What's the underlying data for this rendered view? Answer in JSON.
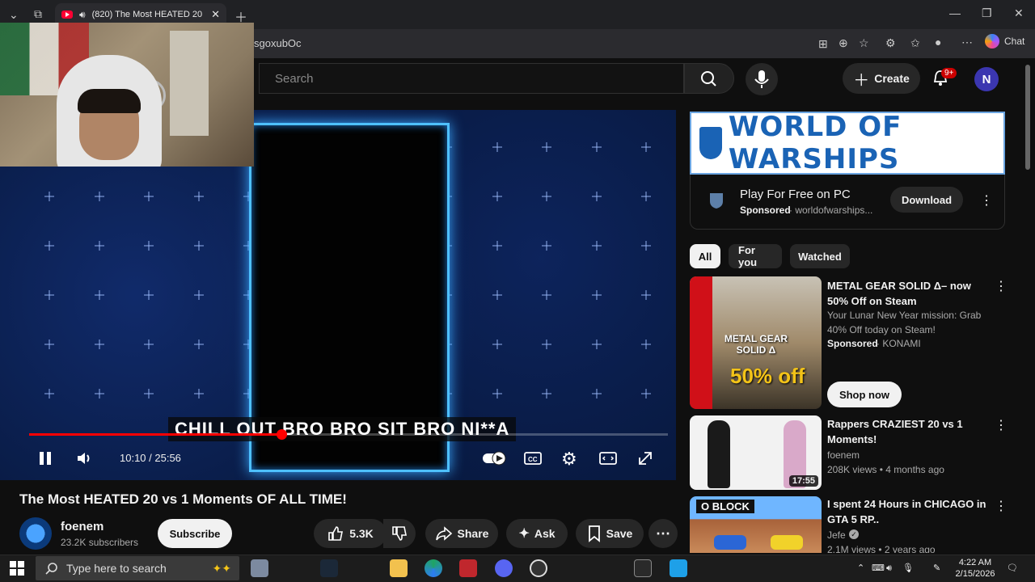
{
  "browser": {
    "tab_title": "(820) The Most HEATED 20 vs",
    "url_fragment": "sgoxubOc",
    "chat_label": "Chat"
  },
  "youtube_header": {
    "search_placeholder": "Search",
    "create_label": "Create",
    "notifications_badge": "9+",
    "avatar_letter": "N"
  },
  "player": {
    "caption": "CHILL OUT BRO BRO SIT BRO NI**A",
    "time": "10:10 / 25:56",
    "progress_fraction": 0.3946
  },
  "video": {
    "title": "The Most HEATED 20 vs 1 Moments OF ALL TIME!",
    "channel_name": "foenem",
    "subscribers": "23.2K subscribers",
    "subscribe_label": "Subscribe",
    "likes": "5.3K",
    "share_label": "Share",
    "ask_label": "Ask",
    "save_label": "Save"
  },
  "ad": {
    "banner_text": "WORLD OF WARSHIPS",
    "headline": "Play For Free on PC",
    "sponsored": "Sponsored",
    "domain": "· worldofwarships...",
    "download_label": "Download"
  },
  "chips": [
    "All",
    "For you",
    "Watched"
  ],
  "recommendations": [
    {
      "title": "METAL GEAR SOLID Δ– now 50% Off on Steam",
      "desc": "Your Lunar New Year mission: Grab 40% Off today on Steam!",
      "sponsored": "Sponsored",
      "channel": "· KONAMI",
      "button": "Shop now",
      "thumb_text": "METAL GEAR SOLID Δ",
      "thumb_offer": "50% off"
    },
    {
      "title": "Rappers CRAZIEST 20 vs 1 Moments!",
      "channel": "foenem",
      "meta": "208K views • 4 months ago",
      "duration": "17:55"
    },
    {
      "title": "I spent 24 Hours in CHICAGO in GTA 5 RP..",
      "channel": "Jefe",
      "meta": "2.1M views • 2 years ago",
      "thumb_text": "O BLOCK"
    }
  ],
  "taskbar": {
    "search_placeholder": "Type here to search",
    "time": "4:22 AM",
    "date": "2/15/2026"
  }
}
